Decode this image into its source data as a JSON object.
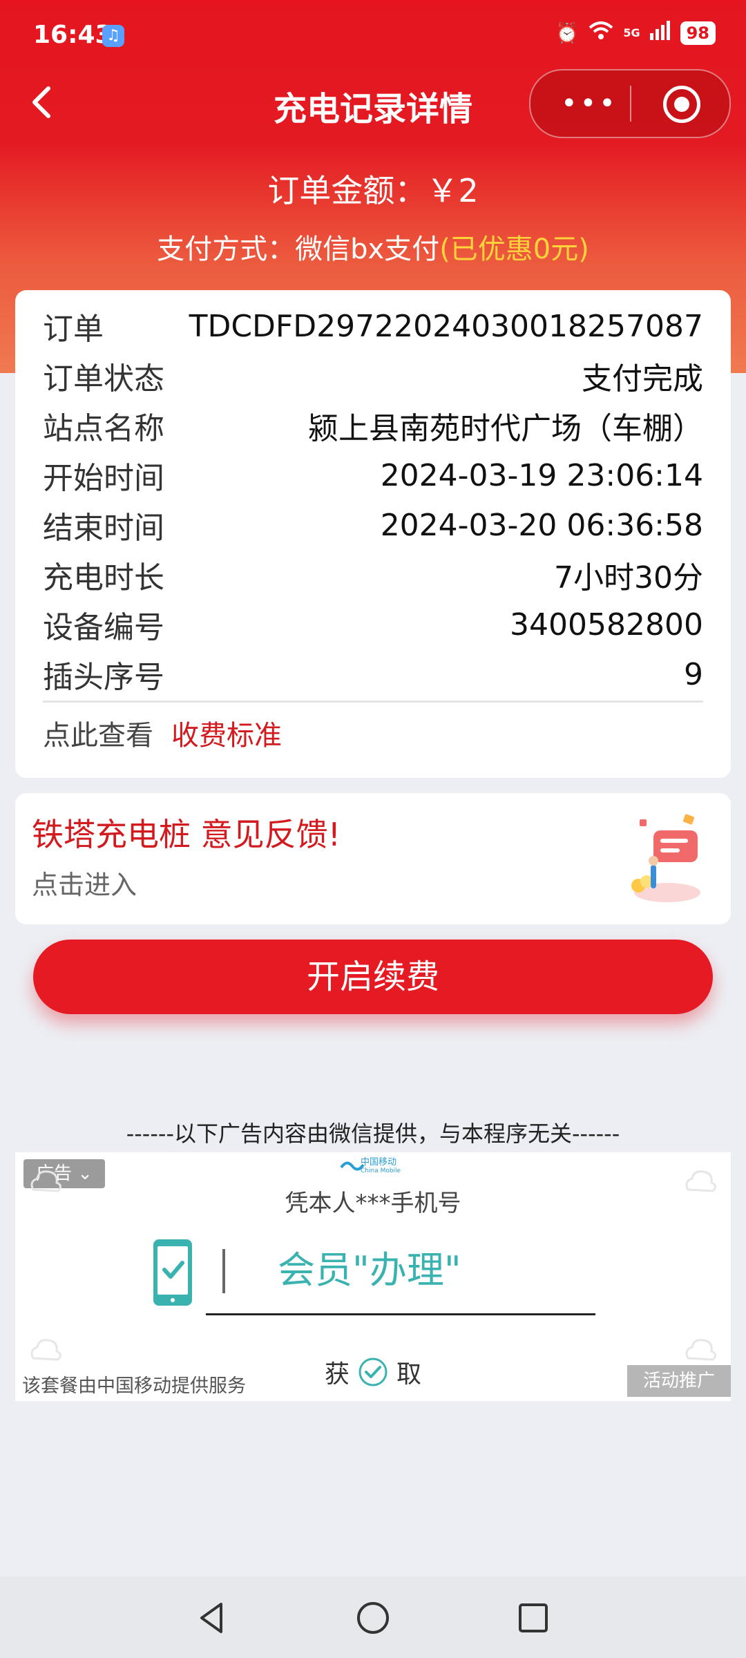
{
  "status_bar": {
    "time": "16:43",
    "network": "5G",
    "battery": "98"
  },
  "nav": {
    "title": "充电记录详情"
  },
  "order_summary": {
    "amount": "订单金额：￥2",
    "pay_method": "支付方式：微信bx支付",
    "discount": "(已优惠0元)"
  },
  "details": {
    "rows": [
      {
        "label": "订单",
        "value": "TDCDFD29722024030018257087"
      },
      {
        "label": "订单状态",
        "value": "支付完成"
      },
      {
        "label": "站点名称",
        "value": "颍上县南苑时代广场（车棚）"
      },
      {
        "label": "开始时间",
        "value": "2024-03-19 23:06:14"
      },
      {
        "label": "结束时间",
        "value": "2024-03-20 06:36:58"
      },
      {
        "label": "充电时长",
        "value": "7小时30分"
      },
      {
        "label": "设备编号",
        "value": "3400582800"
      },
      {
        "label": "插头序号",
        "value": "9"
      }
    ],
    "fee_prefix": "点此查看",
    "fee_link": "收费标准"
  },
  "feedback": {
    "title": "铁塔充电桩 意见反馈!",
    "subtitle": "点击进入"
  },
  "renew_button": "开启续费",
  "ad_disclaimer": "------以下广告内容由微信提供，与本程序无关------",
  "ad": {
    "tag": "广告",
    "brand_cn": "中国移动",
    "brand_en": "China Mobile",
    "subtitle": "凭本人***手机号",
    "main_text": "会员\"办理\"",
    "get_left": "获",
    "get_right": "取",
    "provider": "该套餐由中国移动提供服务",
    "promo": "活动推广"
  },
  "colors": {
    "brand_red": "#e4151f",
    "discount_yellow": "#ffd43a",
    "teal": "#3ab3b0"
  }
}
